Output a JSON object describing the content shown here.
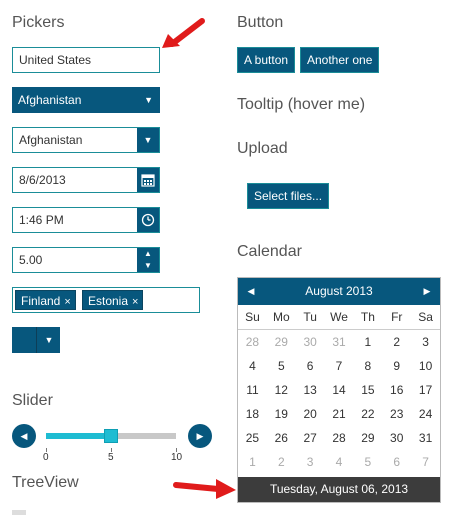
{
  "pickers": {
    "heading": "Pickers",
    "autocomplete_value": "United States",
    "dropdown_primary_value": "Afghanistan",
    "combobox_value": "Afghanistan",
    "date_value": "8/6/2013",
    "time_value": "1:46 PM",
    "numeric_value": "5.00",
    "multiselect_tags": [
      "Finland",
      "Estonia"
    ],
    "tag_remove_glyph": "×"
  },
  "slider": {
    "heading": "Slider",
    "min_label": "0",
    "mid_label": "5",
    "max_label": "10",
    "value": 5,
    "min": 0,
    "max": 10
  },
  "treeview": {
    "heading": "TreeView"
  },
  "button_section": {
    "heading": "Button",
    "button1_label": "A button",
    "button2_label": "Another one"
  },
  "tooltip": {
    "heading": "Tooltip (hover me)"
  },
  "upload": {
    "heading": "Upload",
    "select_label": "Select files..."
  },
  "calendar": {
    "heading": "Calendar",
    "month_title": "August 2013",
    "weekdays": [
      "Su",
      "Mo",
      "Tu",
      "We",
      "Th",
      "Fr",
      "Sa"
    ],
    "weeks": [
      [
        {
          "d": "28",
          "o": true
        },
        {
          "d": "29",
          "o": true
        },
        {
          "d": "30",
          "o": true
        },
        {
          "d": "31",
          "o": true
        },
        {
          "d": "1",
          "o": false
        },
        {
          "d": "2",
          "o": false
        },
        {
          "d": "3",
          "o": false
        }
      ],
      [
        {
          "d": "4",
          "o": false
        },
        {
          "d": "5",
          "o": false
        },
        {
          "d": "6",
          "o": false
        },
        {
          "d": "7",
          "o": false
        },
        {
          "d": "8",
          "o": false
        },
        {
          "d": "9",
          "o": false
        },
        {
          "d": "10",
          "o": false
        }
      ],
      [
        {
          "d": "11",
          "o": false
        },
        {
          "d": "12",
          "o": false
        },
        {
          "d": "13",
          "o": false
        },
        {
          "d": "14",
          "o": false
        },
        {
          "d": "15",
          "o": false
        },
        {
          "d": "16",
          "o": false
        },
        {
          "d": "17",
          "o": false
        }
      ],
      [
        {
          "d": "18",
          "o": false
        },
        {
          "d": "19",
          "o": false
        },
        {
          "d": "20",
          "o": false
        },
        {
          "d": "21",
          "o": false
        },
        {
          "d": "22",
          "o": false
        },
        {
          "d": "23",
          "o": false
        },
        {
          "d": "24",
          "o": false
        }
      ],
      [
        {
          "d": "25",
          "o": false
        },
        {
          "d": "26",
          "o": false
        },
        {
          "d": "27",
          "o": false
        },
        {
          "d": "28",
          "o": false
        },
        {
          "d": "29",
          "o": false
        },
        {
          "d": "30",
          "o": false
        },
        {
          "d": "31",
          "o": false
        }
      ],
      [
        {
          "d": "1",
          "o": true
        },
        {
          "d": "2",
          "o": true
        },
        {
          "d": "3",
          "o": true
        },
        {
          "d": "4",
          "o": true
        },
        {
          "d": "5",
          "o": true
        },
        {
          "d": "6",
          "o": true
        },
        {
          "d": "7",
          "o": true
        }
      ]
    ],
    "footer_text": "Tuesday, August 06, 2013"
  },
  "colors": {
    "primary": "#07577d",
    "border_accent": "#1a8d98",
    "slider_fill": "#1ebcd2",
    "annotation_arrow": "#e01b1b"
  }
}
